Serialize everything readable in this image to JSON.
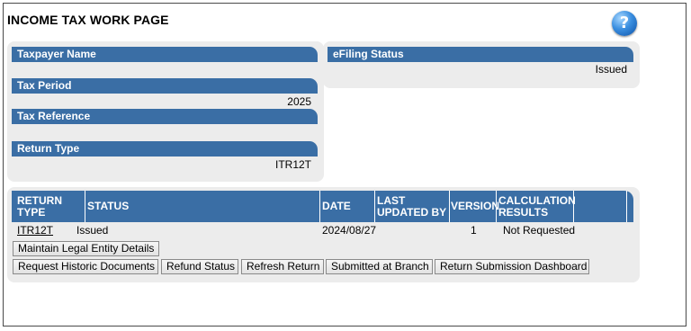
{
  "page": {
    "title": "INCOME TAX WORK PAGE",
    "help_icon": "question-circle-icon"
  },
  "taxpayer_panel": {
    "taxpayer_name_label": "Taxpayer Name",
    "taxpayer_name_value": "",
    "tax_period_label": "Tax Period",
    "tax_period_value": "2025",
    "tax_reference_label": "Tax Reference",
    "tax_reference_value": "",
    "return_type_label": "Return Type",
    "return_type_value": "ITR12T"
  },
  "efiling_panel": {
    "label": "eFiling Status",
    "value": "Issued"
  },
  "returns_table": {
    "headers": {
      "return_type": [
        "RETURN",
        "TYPE"
      ],
      "status": "STATUS",
      "date": "DATE",
      "last_updated_by": [
        "LAST",
        "UPDATED BY"
      ],
      "version": "VERSION",
      "calculation_results": [
        "CALCULATION",
        "RESULTS"
      ]
    },
    "rows": [
      {
        "return_type": "ITR12T",
        "status": "Issued",
        "date": "2024/08/27",
        "last_updated_by": "",
        "version": "1",
        "calculation_results": "Not Requested"
      }
    ]
  },
  "buttons": {
    "maintain_legal_entity": "Maintain Legal Entity Details",
    "request_historic": "Request Historic Documents",
    "refund_status": "Refund Status",
    "refresh_return": "Refresh Return",
    "submitted_at_branch": "Submitted at Branch",
    "submission_dashboard": "Return Submission Dashboard"
  },
  "colors": {
    "header_blue": "#3a6ea5",
    "panel_grey": "#ececec"
  }
}
